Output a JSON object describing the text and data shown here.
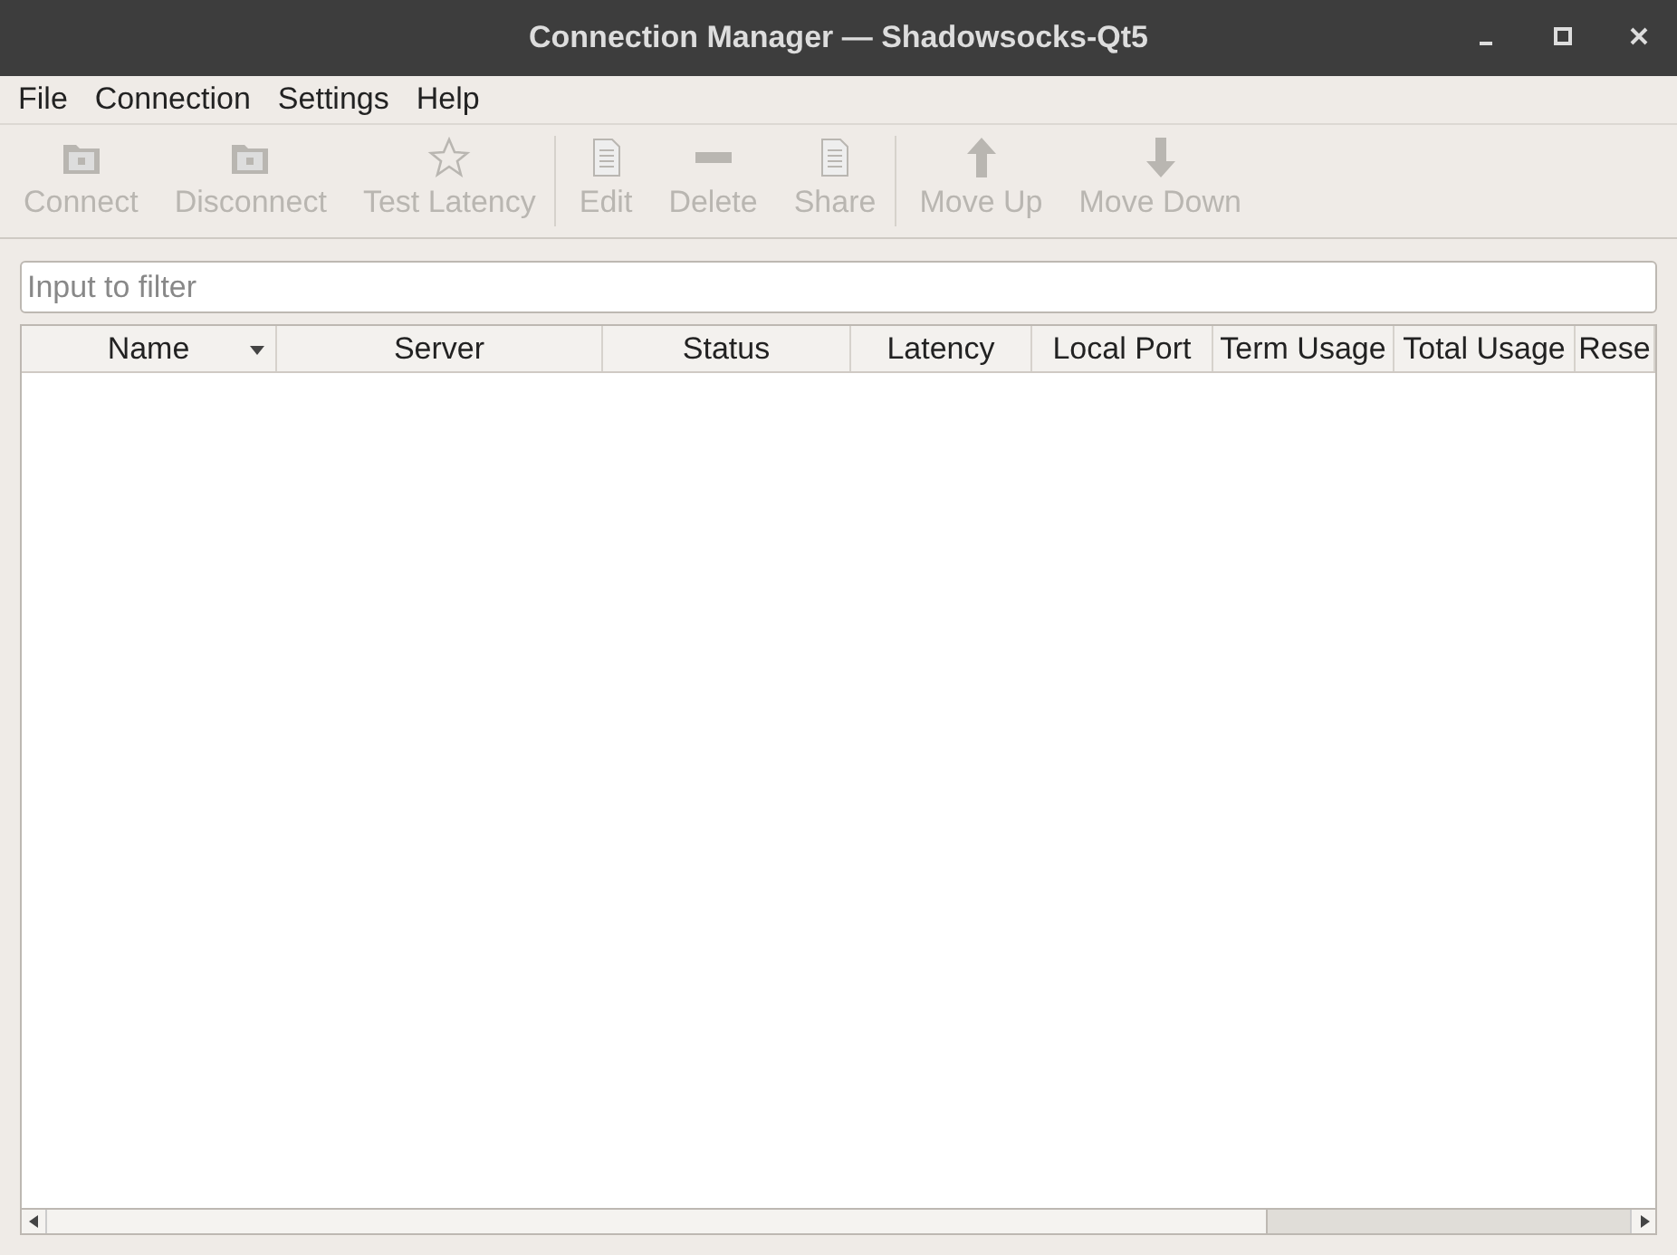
{
  "window": {
    "title": "Connection Manager — Shadowsocks-Qt5"
  },
  "menu": [
    "File",
    "Connection",
    "Settings",
    "Help"
  ],
  "toolbar": [
    [
      {
        "label": "Connect",
        "kind": "folder",
        "disabled": true
      },
      {
        "label": "Disconnect",
        "kind": "folder",
        "disabled": true
      },
      {
        "label": "Test Latency",
        "kind": "star",
        "disabled": true
      }
    ],
    [
      {
        "label": "Edit",
        "kind": "document",
        "disabled": true
      },
      {
        "label": "Delete",
        "kind": "minus",
        "disabled": true
      },
      {
        "label": "Share",
        "kind": "document",
        "disabled": true
      }
    ],
    [
      {
        "label": "Move Up",
        "kind": "up",
        "disabled": true
      },
      {
        "label": "Move Down",
        "kind": "down",
        "disabled": true
      }
    ]
  ],
  "filter": {
    "placeholder": "Input to filter"
  },
  "table": {
    "columns": [
      {
        "label": "Name",
        "sorted": true
      },
      {
        "label": "Server",
        "sorted": false
      },
      {
        "label": "Status",
        "sorted": false
      },
      {
        "label": "Latency",
        "sorted": false
      },
      {
        "label": "Local Port",
        "sorted": false
      },
      {
        "label": "Term Usage",
        "sorted": false
      },
      {
        "label": "Total Usage",
        "sorted": false
      },
      {
        "label": "Rese",
        "sorted": false
      }
    ]
  }
}
